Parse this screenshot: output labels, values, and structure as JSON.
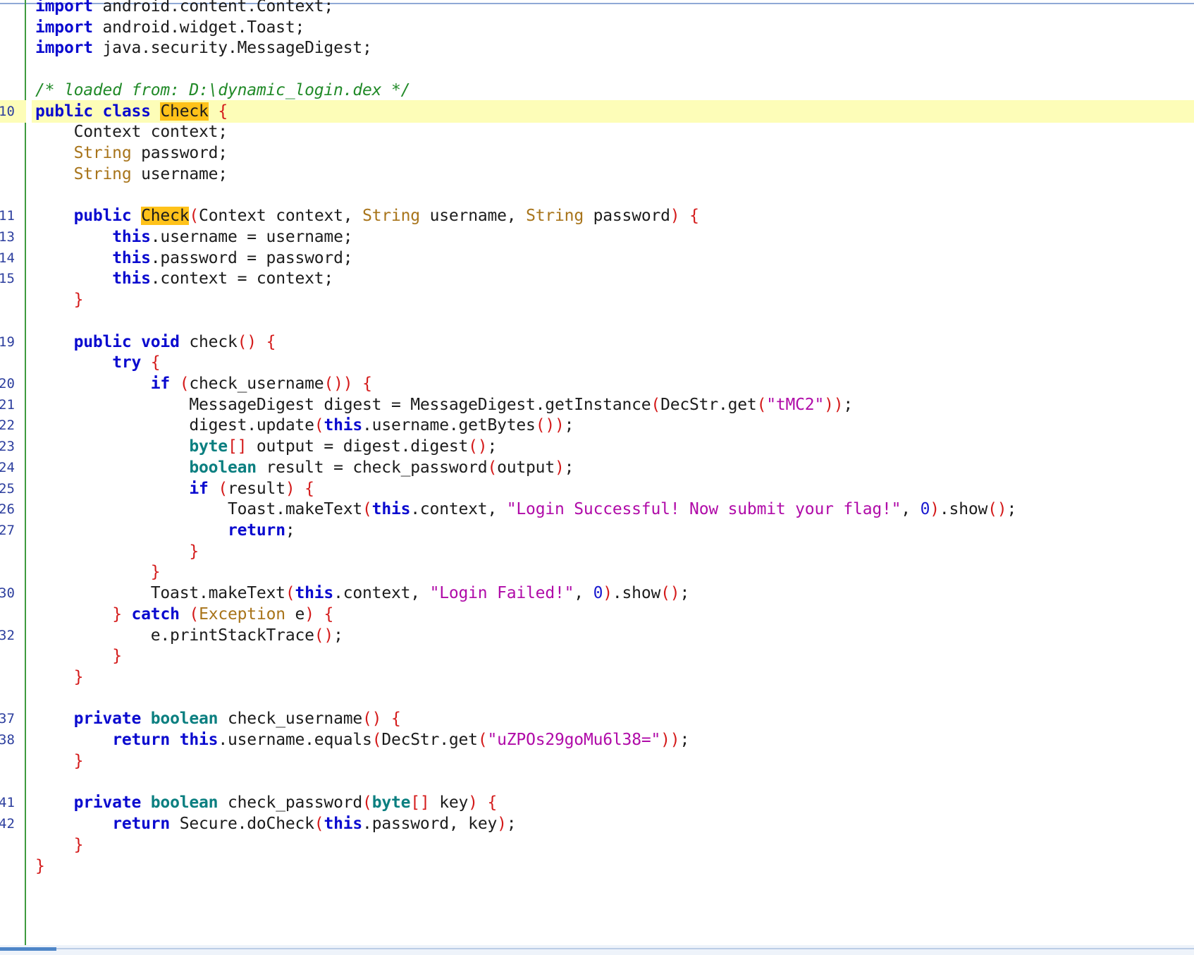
{
  "editor": {
    "language": "java",
    "colors": {
      "keyword": "#0a0acf",
      "primitive": "#0b7f80",
      "type": "#a8741a",
      "string": "#b00ba8",
      "comment": "#218a28",
      "number": "#1a1ad0",
      "punctuation": "#d41a1a",
      "highlight_line": "#fdfdb8",
      "search_match": "#ffc21a"
    },
    "highlighted_line_number": "10",
    "lines": [
      {
        "num": "",
        "tokens": [
          {
            "t": "import",
            "c": "kw"
          },
          {
            "t": " android.content.Context;",
            "c": "pl"
          }
        ]
      },
      {
        "num": "",
        "tokens": [
          {
            "t": "import",
            "c": "kw"
          },
          {
            "t": " android.widget.Toast;",
            "c": "pl"
          }
        ]
      },
      {
        "num": "",
        "tokens": [
          {
            "t": "import",
            "c": "kw"
          },
          {
            "t": " java.security.MessageDigest;",
            "c": "pl"
          }
        ]
      },
      {
        "num": "",
        "tokens": []
      },
      {
        "num": "",
        "tokens": [
          {
            "t": "/* loaded from: D:\\dynamic_login.dex */",
            "c": "cmt"
          }
        ]
      },
      {
        "num": "10",
        "hl": true,
        "tokens": [
          {
            "t": "public",
            "c": "kw"
          },
          {
            "t": " ",
            "c": "pl"
          },
          {
            "t": "class",
            "c": "kw"
          },
          {
            "t": " ",
            "c": "pl"
          },
          {
            "t": "Check",
            "c": "mark"
          },
          {
            "t": " ",
            "c": "pl"
          },
          {
            "t": "{",
            "c": "p"
          }
        ]
      },
      {
        "num": "",
        "tokens": [
          {
            "t": "    Context context;",
            "c": "pl"
          }
        ]
      },
      {
        "num": "",
        "tokens": [
          {
            "t": "    ",
            "c": "pl"
          },
          {
            "t": "String",
            "c": "type"
          },
          {
            "t": " password;",
            "c": "pl"
          }
        ]
      },
      {
        "num": "",
        "tokens": [
          {
            "t": "    ",
            "c": "pl"
          },
          {
            "t": "String",
            "c": "type"
          },
          {
            "t": " username;",
            "c": "pl"
          }
        ]
      },
      {
        "num": "",
        "tokens": []
      },
      {
        "num": "11",
        "tokens": [
          {
            "t": "    ",
            "c": "pl"
          },
          {
            "t": "public",
            "c": "kw"
          },
          {
            "t": " ",
            "c": "pl"
          },
          {
            "t": "Check",
            "c": "mark"
          },
          {
            "t": "(",
            "c": "p"
          },
          {
            "t": "Context context, ",
            "c": "pl"
          },
          {
            "t": "String",
            "c": "type"
          },
          {
            "t": " username, ",
            "c": "pl"
          },
          {
            "t": "String",
            "c": "type"
          },
          {
            "t": " password",
            "c": "pl"
          },
          {
            "t": ")",
            "c": "p"
          },
          {
            "t": " ",
            "c": "pl"
          },
          {
            "t": "{",
            "c": "p"
          }
        ]
      },
      {
        "num": "13",
        "tokens": [
          {
            "t": "        ",
            "c": "pl"
          },
          {
            "t": "this",
            "c": "kw"
          },
          {
            "t": ".username = username;",
            "c": "pl"
          }
        ]
      },
      {
        "num": "14",
        "tokens": [
          {
            "t": "        ",
            "c": "pl"
          },
          {
            "t": "this",
            "c": "kw"
          },
          {
            "t": ".password = password;",
            "c": "pl"
          }
        ]
      },
      {
        "num": "15",
        "tokens": [
          {
            "t": "        ",
            "c": "pl"
          },
          {
            "t": "this",
            "c": "kw"
          },
          {
            "t": ".context = context;",
            "c": "pl"
          }
        ]
      },
      {
        "num": "",
        "tokens": [
          {
            "t": "    ",
            "c": "pl"
          },
          {
            "t": "}",
            "c": "p"
          }
        ]
      },
      {
        "num": "",
        "tokens": []
      },
      {
        "num": "19",
        "tokens": [
          {
            "t": "    ",
            "c": "pl"
          },
          {
            "t": "public",
            "c": "kw"
          },
          {
            "t": " ",
            "c": "pl"
          },
          {
            "t": "void",
            "c": "kw"
          },
          {
            "t": " check",
            "c": "pl"
          },
          {
            "t": "()",
            "c": "p"
          },
          {
            "t": " ",
            "c": "pl"
          },
          {
            "t": "{",
            "c": "p"
          }
        ]
      },
      {
        "num": "",
        "tokens": [
          {
            "t": "        ",
            "c": "pl"
          },
          {
            "t": "try",
            "c": "kw"
          },
          {
            "t": " ",
            "c": "pl"
          },
          {
            "t": "{",
            "c": "p"
          }
        ]
      },
      {
        "num": "20",
        "tokens": [
          {
            "t": "            ",
            "c": "pl"
          },
          {
            "t": "if",
            "c": "kw"
          },
          {
            "t": " ",
            "c": "pl"
          },
          {
            "t": "(",
            "c": "p"
          },
          {
            "t": "check_username",
            "c": "pl"
          },
          {
            "t": "())",
            "c": "p"
          },
          {
            "t": " ",
            "c": "pl"
          },
          {
            "t": "{",
            "c": "p"
          }
        ]
      },
      {
        "num": "21",
        "tokens": [
          {
            "t": "                MessageDigest digest = MessageDigest.getInstance",
            "c": "pl"
          },
          {
            "t": "(",
            "c": "p"
          },
          {
            "t": "DecStr.get",
            "c": "pl"
          },
          {
            "t": "(",
            "c": "p"
          },
          {
            "t": "\"tMC2\"",
            "c": "str"
          },
          {
            "t": "))",
            "c": "p"
          },
          {
            "t": ";",
            "c": "pl"
          }
        ]
      },
      {
        "num": "22",
        "tokens": [
          {
            "t": "                digest.update",
            "c": "pl"
          },
          {
            "t": "(",
            "c": "p"
          },
          {
            "t": "this",
            "c": "kw"
          },
          {
            "t": ".username.getBytes",
            "c": "pl"
          },
          {
            "t": "())",
            "c": "p"
          },
          {
            "t": ";",
            "c": "pl"
          }
        ]
      },
      {
        "num": "23",
        "tokens": [
          {
            "t": "                ",
            "c": "pl"
          },
          {
            "t": "byte",
            "c": "prim"
          },
          {
            "t": "[]",
            "c": "p"
          },
          {
            "t": " output = digest.digest",
            "c": "pl"
          },
          {
            "t": "()",
            "c": "p"
          },
          {
            "t": ";",
            "c": "pl"
          }
        ]
      },
      {
        "num": "24",
        "tokens": [
          {
            "t": "                ",
            "c": "pl"
          },
          {
            "t": "boolean",
            "c": "prim"
          },
          {
            "t": " result = check_password",
            "c": "pl"
          },
          {
            "t": "(",
            "c": "p"
          },
          {
            "t": "output",
            "c": "pl"
          },
          {
            "t": ")",
            "c": "p"
          },
          {
            "t": ";",
            "c": "pl"
          }
        ]
      },
      {
        "num": "25",
        "tokens": [
          {
            "t": "                ",
            "c": "pl"
          },
          {
            "t": "if",
            "c": "kw"
          },
          {
            "t": " ",
            "c": "pl"
          },
          {
            "t": "(",
            "c": "p"
          },
          {
            "t": "result",
            "c": "pl"
          },
          {
            "t": ")",
            "c": "p"
          },
          {
            "t": " ",
            "c": "pl"
          },
          {
            "t": "{",
            "c": "p"
          }
        ]
      },
      {
        "num": "26",
        "tokens": [
          {
            "t": "                    Toast.makeText",
            "c": "pl"
          },
          {
            "t": "(",
            "c": "p"
          },
          {
            "t": "this",
            "c": "kw"
          },
          {
            "t": ".context, ",
            "c": "pl"
          },
          {
            "t": "\"Login Successful! Now submit your flag!\"",
            "c": "str"
          },
          {
            "t": ", ",
            "c": "pl"
          },
          {
            "t": "0",
            "c": "num"
          },
          {
            "t": ")",
            "c": "p"
          },
          {
            "t": ".show",
            "c": "pl"
          },
          {
            "t": "()",
            "c": "p"
          },
          {
            "t": ";",
            "c": "pl"
          }
        ]
      },
      {
        "num": "27",
        "tokens": [
          {
            "t": "                    ",
            "c": "pl"
          },
          {
            "t": "return",
            "c": "kw"
          },
          {
            "t": ";",
            "c": "pl"
          }
        ]
      },
      {
        "num": "",
        "tokens": [
          {
            "t": "                ",
            "c": "pl"
          },
          {
            "t": "}",
            "c": "p"
          }
        ]
      },
      {
        "num": "",
        "tokens": [
          {
            "t": "            ",
            "c": "pl"
          },
          {
            "t": "}",
            "c": "p"
          }
        ]
      },
      {
        "num": "30",
        "tokens": [
          {
            "t": "            Toast.makeText",
            "c": "pl"
          },
          {
            "t": "(",
            "c": "p"
          },
          {
            "t": "this",
            "c": "kw"
          },
          {
            "t": ".context, ",
            "c": "pl"
          },
          {
            "t": "\"Login Failed!\"",
            "c": "str"
          },
          {
            "t": ", ",
            "c": "pl"
          },
          {
            "t": "0",
            "c": "num"
          },
          {
            "t": ")",
            "c": "p"
          },
          {
            "t": ".show",
            "c": "pl"
          },
          {
            "t": "()",
            "c": "p"
          },
          {
            "t": ";",
            "c": "pl"
          }
        ]
      },
      {
        "num": "",
        "tokens": [
          {
            "t": "        ",
            "c": "pl"
          },
          {
            "t": "}",
            "c": "p"
          },
          {
            "t": " ",
            "c": "pl"
          },
          {
            "t": "catch",
            "c": "kw"
          },
          {
            "t": " ",
            "c": "pl"
          },
          {
            "t": "(",
            "c": "p"
          },
          {
            "t": "Exception",
            "c": "type"
          },
          {
            "t": " e",
            "c": "pl"
          },
          {
            "t": ")",
            "c": "p"
          },
          {
            "t": " ",
            "c": "pl"
          },
          {
            "t": "{",
            "c": "p"
          }
        ]
      },
      {
        "num": "32",
        "tokens": [
          {
            "t": "            e.printStackTrace",
            "c": "pl"
          },
          {
            "t": "()",
            "c": "p"
          },
          {
            "t": ";",
            "c": "pl"
          }
        ]
      },
      {
        "num": "",
        "tokens": [
          {
            "t": "        ",
            "c": "pl"
          },
          {
            "t": "}",
            "c": "p"
          }
        ]
      },
      {
        "num": "",
        "tokens": [
          {
            "t": "    ",
            "c": "pl"
          },
          {
            "t": "}",
            "c": "p"
          }
        ]
      },
      {
        "num": "",
        "tokens": []
      },
      {
        "num": "37",
        "tokens": [
          {
            "t": "    ",
            "c": "pl"
          },
          {
            "t": "private",
            "c": "kw"
          },
          {
            "t": " ",
            "c": "pl"
          },
          {
            "t": "boolean",
            "c": "prim"
          },
          {
            "t": " check_username",
            "c": "pl"
          },
          {
            "t": "()",
            "c": "p"
          },
          {
            "t": " ",
            "c": "pl"
          },
          {
            "t": "{",
            "c": "p"
          }
        ]
      },
      {
        "num": "38",
        "tokens": [
          {
            "t": "        ",
            "c": "pl"
          },
          {
            "t": "return",
            "c": "kw"
          },
          {
            "t": " ",
            "c": "pl"
          },
          {
            "t": "this",
            "c": "kw"
          },
          {
            "t": ".username.equals",
            "c": "pl"
          },
          {
            "t": "(",
            "c": "p"
          },
          {
            "t": "DecStr.get",
            "c": "pl"
          },
          {
            "t": "(",
            "c": "p"
          },
          {
            "t": "\"uZPOs29goMu6l38=\"",
            "c": "str"
          },
          {
            "t": "))",
            "c": "p"
          },
          {
            "t": ";",
            "c": "pl"
          }
        ]
      },
      {
        "num": "",
        "tokens": [
          {
            "t": "    ",
            "c": "pl"
          },
          {
            "t": "}",
            "c": "p"
          }
        ]
      },
      {
        "num": "",
        "tokens": []
      },
      {
        "num": "41",
        "tokens": [
          {
            "t": "    ",
            "c": "pl"
          },
          {
            "t": "private",
            "c": "kw"
          },
          {
            "t": " ",
            "c": "pl"
          },
          {
            "t": "boolean",
            "c": "prim"
          },
          {
            "t": " check_password",
            "c": "pl"
          },
          {
            "t": "(",
            "c": "p"
          },
          {
            "t": "byte",
            "c": "prim"
          },
          {
            "t": "[]",
            "c": "p"
          },
          {
            "t": " key",
            "c": "pl"
          },
          {
            "t": ")",
            "c": "p"
          },
          {
            "t": " ",
            "c": "pl"
          },
          {
            "t": "{",
            "c": "p"
          }
        ]
      },
      {
        "num": "42",
        "tokens": [
          {
            "t": "        ",
            "c": "pl"
          },
          {
            "t": "return",
            "c": "kw"
          },
          {
            "t": " Secure.doCheck",
            "c": "pl"
          },
          {
            "t": "(",
            "c": "p"
          },
          {
            "t": "this",
            "c": "kw"
          },
          {
            "t": ".password, key",
            "c": "pl"
          },
          {
            "t": ")",
            "c": "p"
          },
          {
            "t": ";",
            "c": "pl"
          }
        ]
      },
      {
        "num": "",
        "tokens": [
          {
            "t": "    ",
            "c": "pl"
          },
          {
            "t": "}",
            "c": "p"
          }
        ]
      },
      {
        "num": "",
        "tokens": [
          {
            "t": "}",
            "c": "p"
          }
        ]
      }
    ]
  }
}
